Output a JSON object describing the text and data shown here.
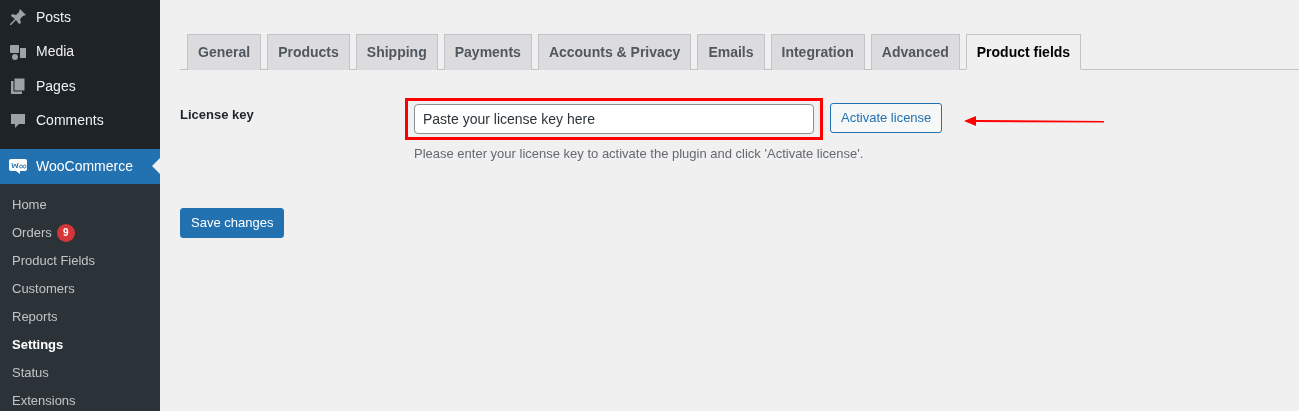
{
  "sidebar": {
    "items": [
      {
        "label": "Posts",
        "kind": "pin",
        "selected": false
      },
      {
        "label": "Media",
        "kind": "media",
        "selected": false
      },
      {
        "label": "Pages",
        "kind": "pages",
        "selected": false
      },
      {
        "label": "Comments",
        "kind": "comment",
        "selected": false
      },
      {
        "label": "WooCommerce",
        "kind": "woo",
        "selected": true,
        "children": [
          {
            "label": "Home",
            "selected": false
          },
          {
            "label": "Orders",
            "badge": "9",
            "selected": false
          },
          {
            "label": "Product Fields",
            "selected": false
          },
          {
            "label": "Customers",
            "selected": false
          },
          {
            "label": "Reports",
            "selected": false
          },
          {
            "label": "Settings",
            "selected": true
          },
          {
            "label": "Status",
            "selected": false
          },
          {
            "label": "Extensions",
            "selected": false
          }
        ]
      }
    ]
  },
  "tabs": [
    {
      "label": "General",
      "selected": false
    },
    {
      "label": "Products",
      "selected": false
    },
    {
      "label": "Shipping",
      "selected": false
    },
    {
      "label": "Payments",
      "selected": false
    },
    {
      "label": "Accounts & Privacy",
      "selected": false
    },
    {
      "label": "Emails",
      "selected": false
    },
    {
      "label": "Integration",
      "selected": false
    },
    {
      "label": "Advanced",
      "selected": false
    },
    {
      "label": "Product fields",
      "selected": true
    }
  ],
  "license": {
    "label": "License key",
    "placeholder": "Paste your license key here",
    "button": "Activate license",
    "description": "Please enter your license key to activate the plugin and click 'Activate license'."
  },
  "save_button": "Save changes"
}
